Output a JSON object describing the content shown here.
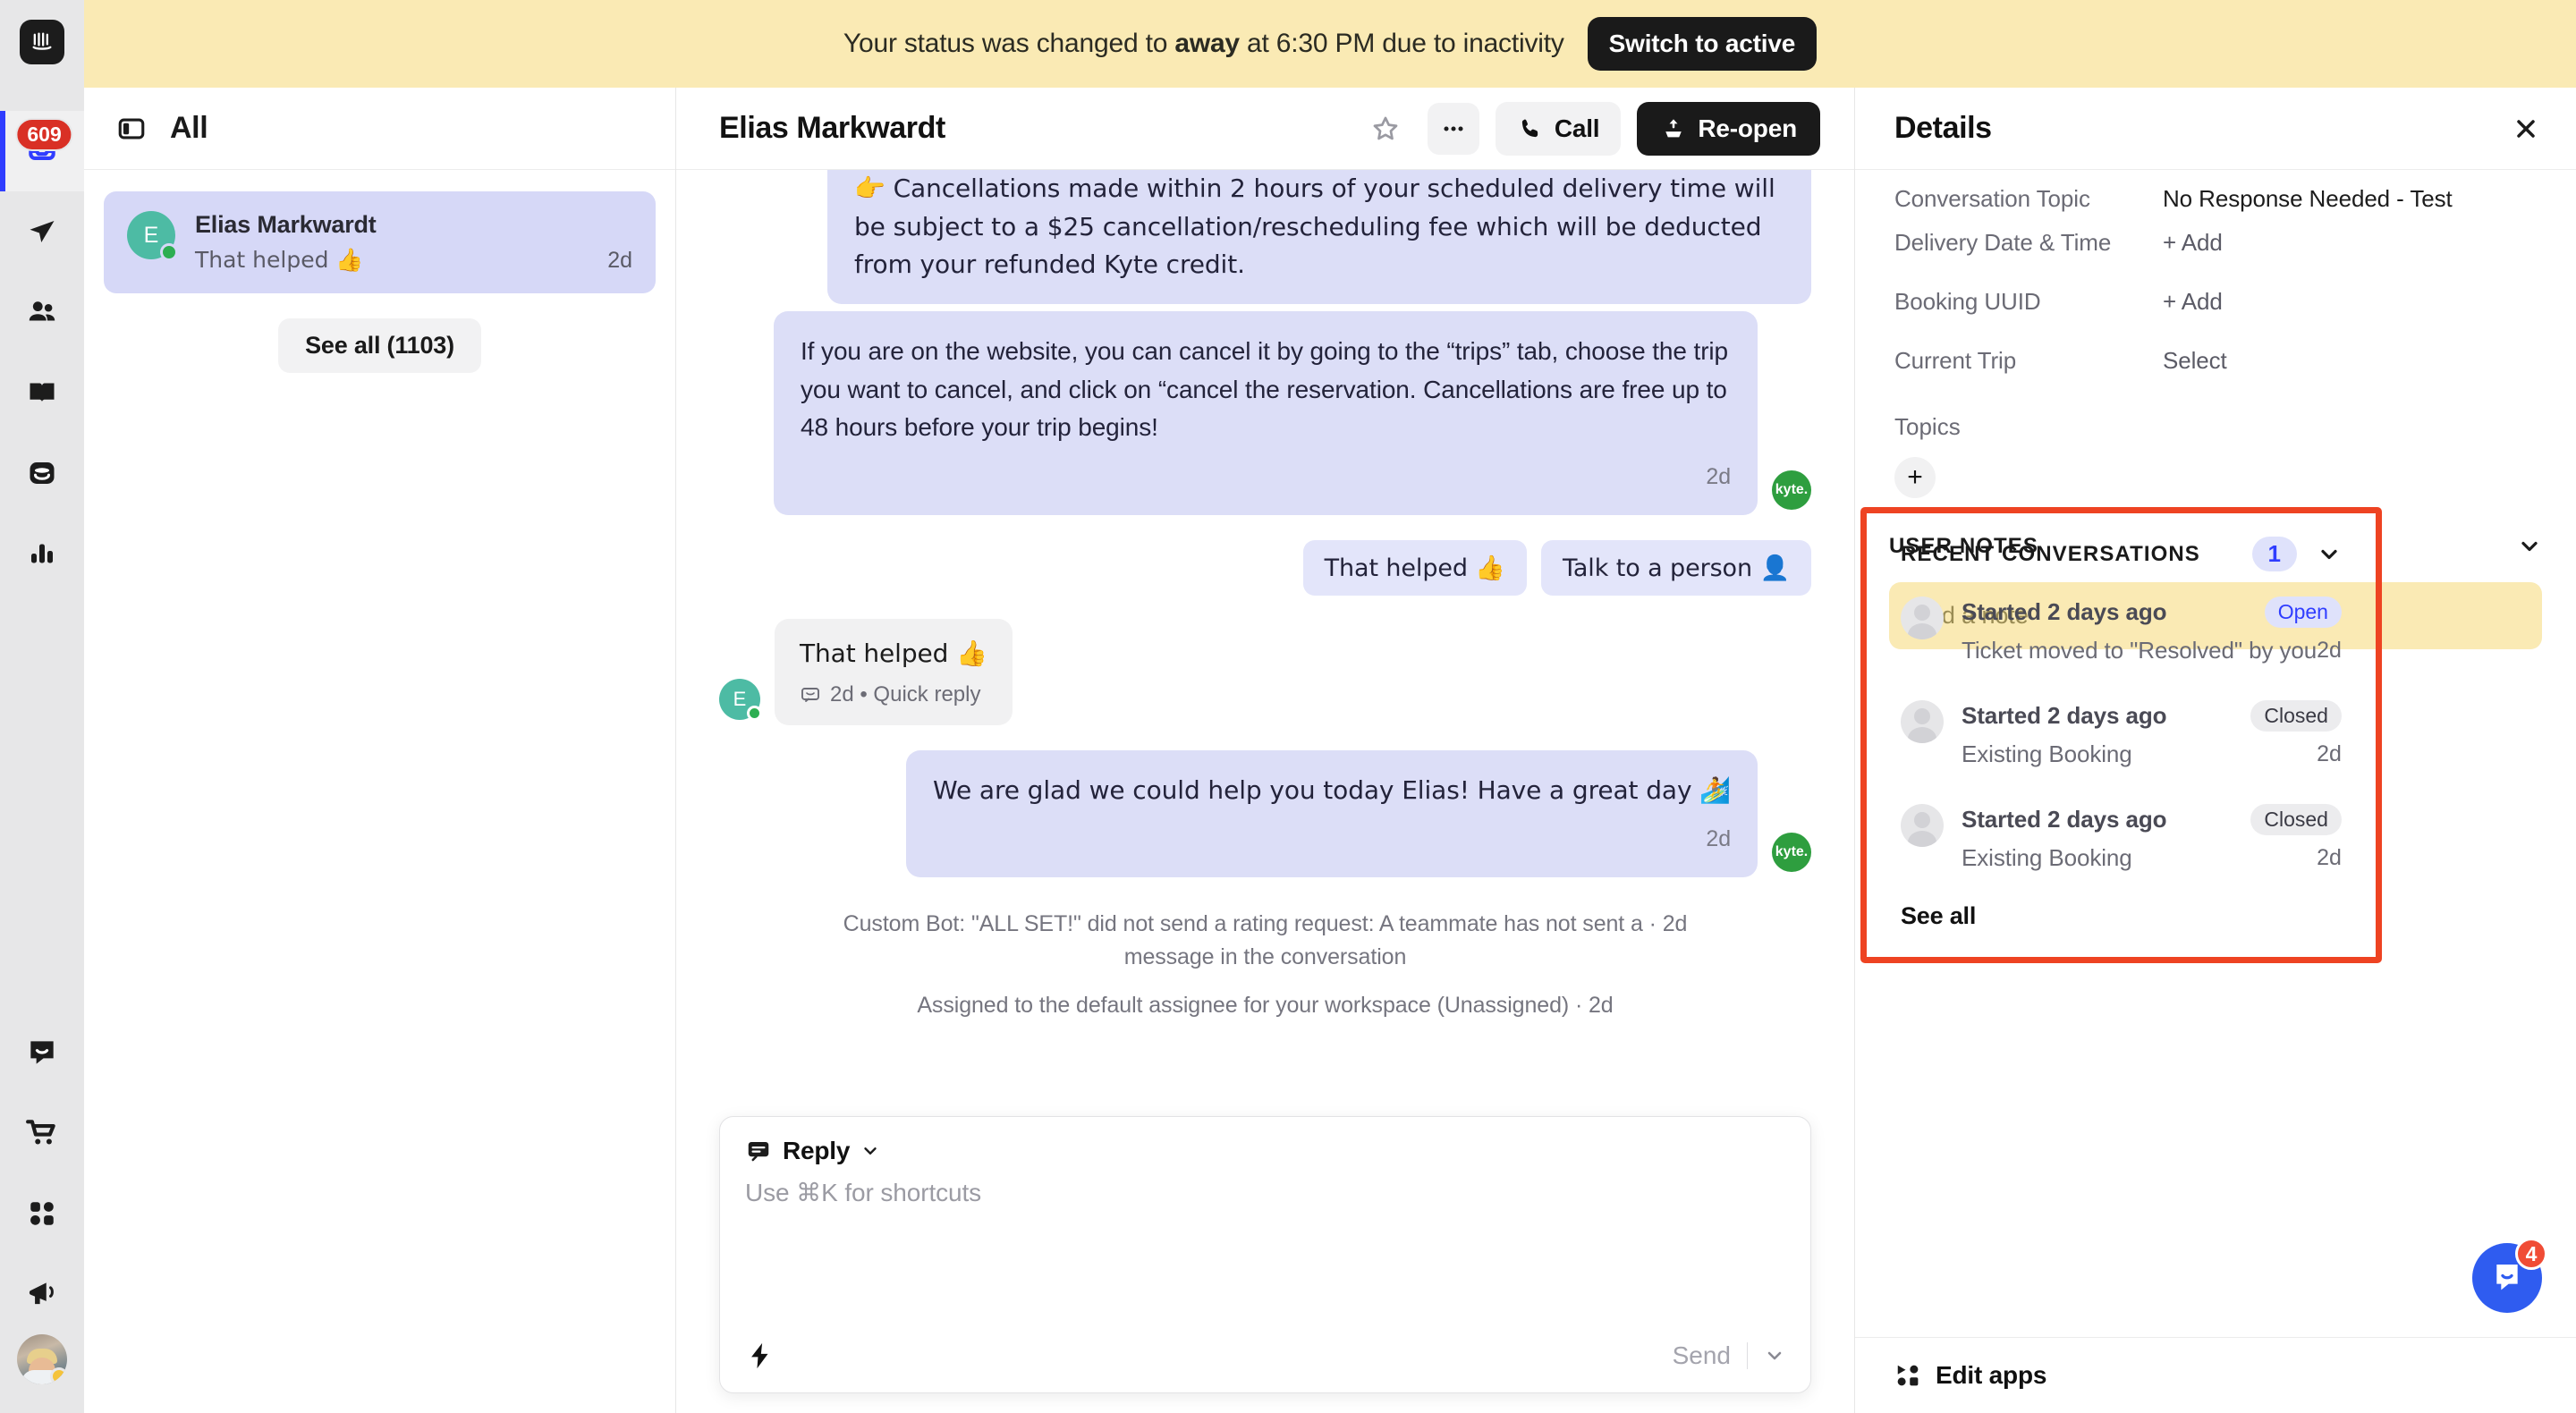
{
  "banner": {
    "text_before": "Your status was changed to ",
    "text_bold": "away",
    "text_after": " at 6:30 PM due to inactivity",
    "button": "Switch to active",
    "bg": "#faeab4"
  },
  "rail": {
    "logo": "intercom-logo",
    "badge": "609",
    "items": [
      {
        "name": "inbox",
        "icon": "inbox-icon",
        "active": true
      },
      {
        "name": "outbound",
        "icon": "paper-plane-icon",
        "active": false
      },
      {
        "name": "contacts",
        "icon": "people-icon",
        "active": false
      },
      {
        "name": "knowledge",
        "icon": "book-icon",
        "active": false
      },
      {
        "name": "data",
        "icon": "database-icon",
        "active": false
      },
      {
        "name": "reports",
        "icon": "bar-chart-icon",
        "active": false
      }
    ],
    "bottom_items": [
      {
        "name": "messenger",
        "icon": "chat-bubble-icon"
      },
      {
        "name": "commerce",
        "icon": "shopping-cart-icon"
      },
      {
        "name": "apps",
        "icon": "apps-grid-icon"
      },
      {
        "name": "news",
        "icon": "megaphone-icon"
      }
    ],
    "avatar_status_color": "#f5c33b"
  },
  "list": {
    "title": "All",
    "toggle_icon": "panel-toggle-icon",
    "conversation": {
      "initial": "E",
      "name": "Elias Markwardt",
      "preview": "That helped 👍",
      "time": "2d"
    },
    "see_all": "See all (1103)"
  },
  "conversation": {
    "title": "Elias Markwardt",
    "star_icon": "star-icon",
    "more_icon": "ellipsis-icon",
    "call_label": "Call",
    "call_icon": "phone-icon",
    "reopen_label": "Re-open",
    "reopen_icon": "reopen-arrow-icon",
    "messages": [
      {
        "type": "outbound",
        "clipped": true,
        "text": "👉 Cancellations made within 2 hours of your scheduled delivery time will be subject to a $25 cancellation/rescheduling fee which will be deducted from your refunded Kyte credit."
      },
      {
        "type": "outbound",
        "text": "If you are on the website, you can cancel it by going to the “trips” tab, choose the trip you want to cancel, and click on “cancel the reservation. Cancellations are free up to 48 hours before your trip begins!",
        "time": "2d",
        "avatar": "kyte."
      }
    ],
    "quick_replies": [
      "That helped 👍",
      "Talk to a person 👤"
    ],
    "inbound_message": {
      "initial": "E",
      "text": "That helped 👍",
      "meta_icon": "quick-reply-icon",
      "meta": "2d • Quick reply"
    },
    "final_message": {
      "text": "We are glad we could help you today Elias! Have a great day 🏄",
      "time": "2d",
      "avatar": "kyte."
    },
    "system_events": [
      "Custom Bot: \"ALL SET!\" did not send a rating request: A teammate has not sent a · 2d message in the conversation",
      "Assigned to the default assignee for your workspace (Unassigned) · 2d"
    ],
    "composer": {
      "mode": "Reply",
      "mode_icon": "reply-icon",
      "chevron_icon": "chevron-down-icon",
      "placeholder": "Use ⌘K for shortcuts",
      "shortcut_icon": "lightning-icon",
      "send_label": "Send",
      "send_chevron_icon": "chevron-down-icon"
    }
  },
  "details": {
    "title": "Details",
    "close_icon": "close-icon",
    "attributes": [
      {
        "key": "Conversation Topic",
        "value": "No Response Needed - Test",
        "clipped": true
      },
      {
        "key": "Delivery Date & Time",
        "value": "+ Add"
      },
      {
        "key": "Booking UUID",
        "value": "+ Add"
      },
      {
        "key": "Current Trip",
        "value": "Select"
      }
    ],
    "topics": {
      "label": "Topics",
      "add_icon": "plus-icon"
    },
    "recent_conversations": {
      "title": "RECENT CONVERSATIONS",
      "count": "1",
      "chevron_icon": "chevron-down-icon",
      "highlight_color": "#ee4322",
      "items": [
        {
          "title": "Started 2 days ago",
          "preview": "Ticket moved to \"Resolved\" by you",
          "time": "2d",
          "status": "Open",
          "status_type": "open"
        },
        {
          "title": "Started 2 days ago",
          "preview": "Existing Booking",
          "time": "2d",
          "status": "Closed",
          "status_type": "closed"
        },
        {
          "title": "Started 2 days ago",
          "preview": "Existing Booking",
          "time": "2d",
          "status": "Closed",
          "status_type": "closed"
        }
      ],
      "see_all": "See all"
    },
    "user_notes": {
      "title": "USER NOTES",
      "chevron_icon": "chevron-down-icon",
      "placeholder": "Add a note"
    },
    "footer": {
      "label": "Edit apps",
      "icon": "apps-grid-icon"
    }
  },
  "launcher": {
    "icon": "messenger-icon",
    "badge": "4",
    "color": "#2f5cf0"
  }
}
